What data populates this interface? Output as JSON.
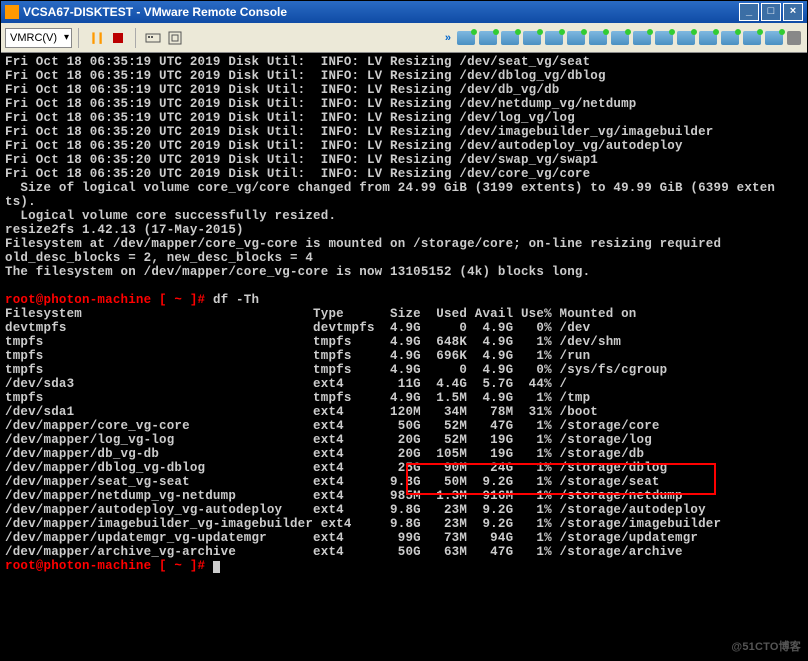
{
  "window": {
    "title": "VCSA67-DISKTEST - VMware Remote Console"
  },
  "toolbar": {
    "dropdown": "VMRC(V)",
    "arrows": "»"
  },
  "prompt": "root@photon-machine [ ~ ]#",
  "cmd_df": "df -Th",
  "log_lines": [
    "Fri Oct 18 06:35:19 UTC 2019 Disk Util:  INFO: LV Resizing /dev/seat_vg/seat",
    "Fri Oct 18 06:35:19 UTC 2019 Disk Util:  INFO: LV Resizing /dev/dblog_vg/dblog",
    "Fri Oct 18 06:35:19 UTC 2019 Disk Util:  INFO: LV Resizing /dev/db_vg/db",
    "Fri Oct 18 06:35:19 UTC 2019 Disk Util:  INFO: LV Resizing /dev/netdump_vg/netdump",
    "Fri Oct 18 06:35:19 UTC 2019 Disk Util:  INFO: LV Resizing /dev/log_vg/log",
    "Fri Oct 18 06:35:20 UTC 2019 Disk Util:  INFO: LV Resizing /dev/imagebuilder_vg/imagebuilder",
    "Fri Oct 18 06:35:20 UTC 2019 Disk Util:  INFO: LV Resizing /dev/autodeploy_vg/autodeploy",
    "Fri Oct 18 06:35:20 UTC 2019 Disk Util:  INFO: LV Resizing /dev/swap_vg/swap1",
    "Fri Oct 18 06:35:20 UTC 2019 Disk Util:  INFO: LV Resizing /dev/core_vg/core",
    "  Size of logical volume core_vg/core changed from 24.99 GiB (3199 extents) to 49.99 GiB (6399 exten",
    "ts).",
    "  Logical volume core successfully resized.",
    "resize2fs 1.42.13 (17-May-2015)",
    "Filesystem at /dev/mapper/core_vg-core is mounted on /storage/core; on-line resizing required",
    "old_desc_blocks = 2, new_desc_blocks = 4",
    "The filesystem on /dev/mapper/core_vg-core is now 13105152 (4k) blocks long.",
    ""
  ],
  "df_header": "Filesystem                              Type      Size  Used Avail Use% Mounted on",
  "df_rows": [
    "devtmpfs                                devtmpfs  4.9G     0  4.9G   0% /dev",
    "tmpfs                                   tmpfs     4.9G  648K  4.9G   1% /dev/shm",
    "tmpfs                                   tmpfs     4.9G  696K  4.9G   1% /run",
    "tmpfs                                   tmpfs     4.9G     0  4.9G   0% /sys/fs/cgroup",
    "/dev/sda3                               ext4       11G  4.4G  5.7G  44% /",
    "tmpfs                                   tmpfs     4.9G  1.5M  4.9G   1% /tmp",
    "/dev/sda1                               ext4      120M   34M   78M  31% /boot",
    "/dev/mapper/core_vg-core                ext4       50G   52M   47G   1% /storage/core",
    "/dev/mapper/log_vg-log                  ext4       20G   52M   19G   1% /storage/log",
    "/dev/mapper/db_vg-db                    ext4       20G  105M   19G   1% /storage/db",
    "/dev/mapper/dblog_vg-dblog              ext4       25G   90M   24G   1% /storage/dblog",
    "/dev/mapper/seat_vg-seat                ext4      9.8G   50M  9.2G   1% /storage/seat",
    "/dev/mapper/netdump_vg-netdump          ext4      985M  1.3M  916M   1% /storage/netdump",
    "/dev/mapper/autodeploy_vg-autodeploy    ext4      9.8G   23M  9.2G   1% /storage/autodeploy",
    "/dev/mapper/imagebuilder_vg-imagebuilder ext4     9.8G   23M  9.2G   1% /storage/imagebuilder",
    "/dev/mapper/updatemgr_vg-updatemgr      ext4       99G   73M   94G   1% /storage/updatemgr",
    "/dev/mapper/archive_vg-archive          ext4       50G   63M   47G   1% /storage/archive"
  ],
  "watermark": "@51CTO博客"
}
